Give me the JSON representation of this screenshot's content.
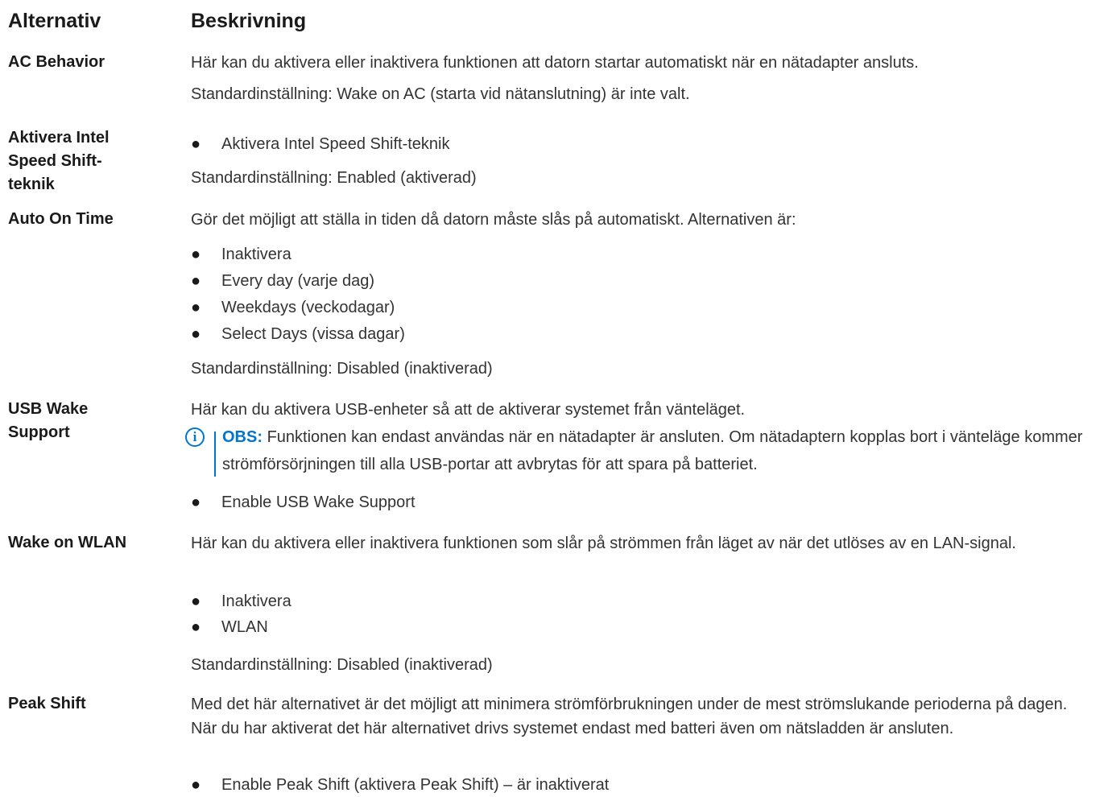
{
  "header": {
    "option": "Alternativ",
    "description": "Beskrivning"
  },
  "rows": [
    {
      "option": "AC Behavior",
      "description": "Här kan du aktivera eller inaktivera funktionen att datorn startar automatiskt när en nätadapter ansluts.",
      "default": "Standardinställning: Wake on AC (starta vid nätanslutning) är inte valt."
    },
    {
      "option": "Aktivera Intel Speed Shift-teknik",
      "bullets": [
        "Aktivera Intel Speed Shift-teknik"
      ],
      "default": "Standardinställning: Enabled (aktiverad)"
    },
    {
      "option": "Auto On Time",
      "description": "Gör det möjligt att ställa in tiden då datorn måste slås på automatiskt. Alternativen är:",
      "bullets": [
        "Inaktivera",
        "Every day (varje dag)",
        "Weekdays (veckodagar)",
        "Select Days (vissa dagar)"
      ],
      "default": "Standardinställning: Disabled (inaktiverad)"
    },
    {
      "option": "USB Wake Support",
      "description": "Här kan du aktivera USB-enheter så att de aktiverar systemet från vänteläget.",
      "note_label": "OBS:",
      "note_text": "Funktionen kan endast användas när en nätadapter är ansluten. Om nätadaptern kopplas bort i vänteläge kommer strömförsörjningen till alla USB-portar att avbrytas för att spara på batteriet.",
      "bullets": [
        "Enable USB Wake Support"
      ]
    },
    {
      "option": "Wake on WLAN",
      "description": "Här kan du aktivera eller inaktivera funktionen som slår på strömmen från läget av när det utlöses av en LAN-signal.",
      "bullets": [
        "Inaktivera",
        "WLAN"
      ],
      "default": "Standardinställning: Disabled (inaktiverad)"
    },
    {
      "option": "Peak Shift",
      "description": "Med det här alternativet är det möjligt att minimera strömförbrukningen under de mest strömslukande perioderna på dagen. När du har aktiverat det här alternativet drivs systemet endast med batteri även om nätsladden är ansluten.",
      "bullets": [
        "Enable Peak Shift (aktivera Peak Shift) – är inaktiverat"
      ]
    }
  ],
  "icons": {
    "note": "info-icon",
    "bullet": "bullet-dot"
  },
  "colors": {
    "accent": "#0076ce",
    "text": "#333333",
    "heading": "#1a1a1a"
  }
}
